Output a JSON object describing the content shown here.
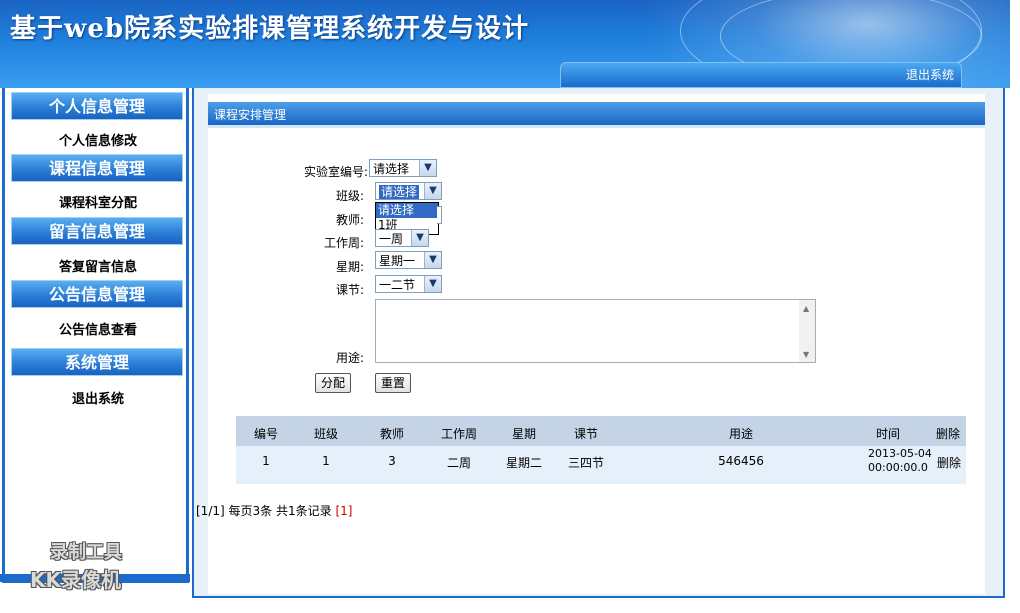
{
  "app_title": "基于web院系实验排课管理系统开发与设计",
  "header_logout": "退出系统",
  "sidebar": {
    "sections": [
      {
        "title": "个人信息管理",
        "items": [
          "个人信息修改"
        ]
      },
      {
        "title": "课程信息管理",
        "items": [
          "课程科室分配"
        ]
      },
      {
        "title": "留言信息管理",
        "items": [
          "答复留言信息"
        ]
      },
      {
        "title": "公告信息管理",
        "items": [
          "公告信息查看"
        ]
      },
      {
        "title": "系统管理",
        "items": [
          "退出系统"
        ]
      }
    ]
  },
  "watermark": {
    "line1": "录制工具",
    "line2": "KK录像机"
  },
  "panel_title": "课程安排管理",
  "form": {
    "lab_label": "实验室编号:",
    "lab_value": "请选择",
    "class_label": "班级:",
    "class_value": "请选择",
    "class_options": [
      "请选择",
      "1班"
    ],
    "teacher_label": "教师:",
    "week_label": "工作周:",
    "week_value": "一周",
    "day_label": "星期:",
    "day_value": "星期一",
    "period_label": "课节:",
    "period_value": "一二节",
    "purpose_label": "用途:",
    "assign_button": "分配",
    "reset_button": "重置"
  },
  "table": {
    "headers": [
      "编号",
      "班级",
      "教师",
      "工作周",
      "星期",
      "课节",
      "用途",
      "时间",
      "删除"
    ],
    "rows": [
      {
        "id": "1",
        "class": "1",
        "teacher": "3",
        "week": "二周",
        "day": "星期二",
        "period": "三四节",
        "purpose": "546456",
        "time_date": "2013-05-04",
        "time_clock": "00:00:00.0",
        "delete": "删除"
      }
    ]
  },
  "pager": {
    "page_info": "[1/1]",
    "per_page": "每页3条",
    "total": "共1条记录",
    "pages": "[1]"
  },
  "colors": {
    "brand_blue": "#1c6acb",
    "header_row": "#c4d4e6",
    "data_row": "#e6f0fa"
  }
}
